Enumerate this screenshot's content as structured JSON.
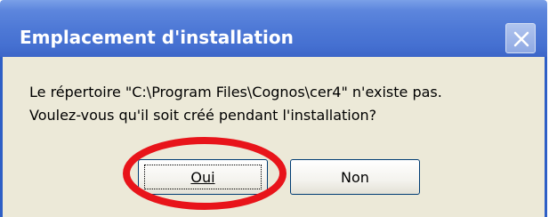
{
  "dialog": {
    "title": "Emplacement d'installation",
    "message_line1": "Le répertoire \"C:\\Program Files\\Cognos\\cer4\" n'existe pas.",
    "message_line2": "Voulez-vous qu'il soit créé pendant l'installation?",
    "buttons": {
      "yes_label": "Oui",
      "no_label": "Non"
    }
  },
  "icons": {
    "close": "close-icon"
  },
  "colors": {
    "titlebar": "#4e79d6",
    "dialog_body": "#ece9d8",
    "highlight_ring": "#e8141a",
    "button_border": "#003c74"
  }
}
